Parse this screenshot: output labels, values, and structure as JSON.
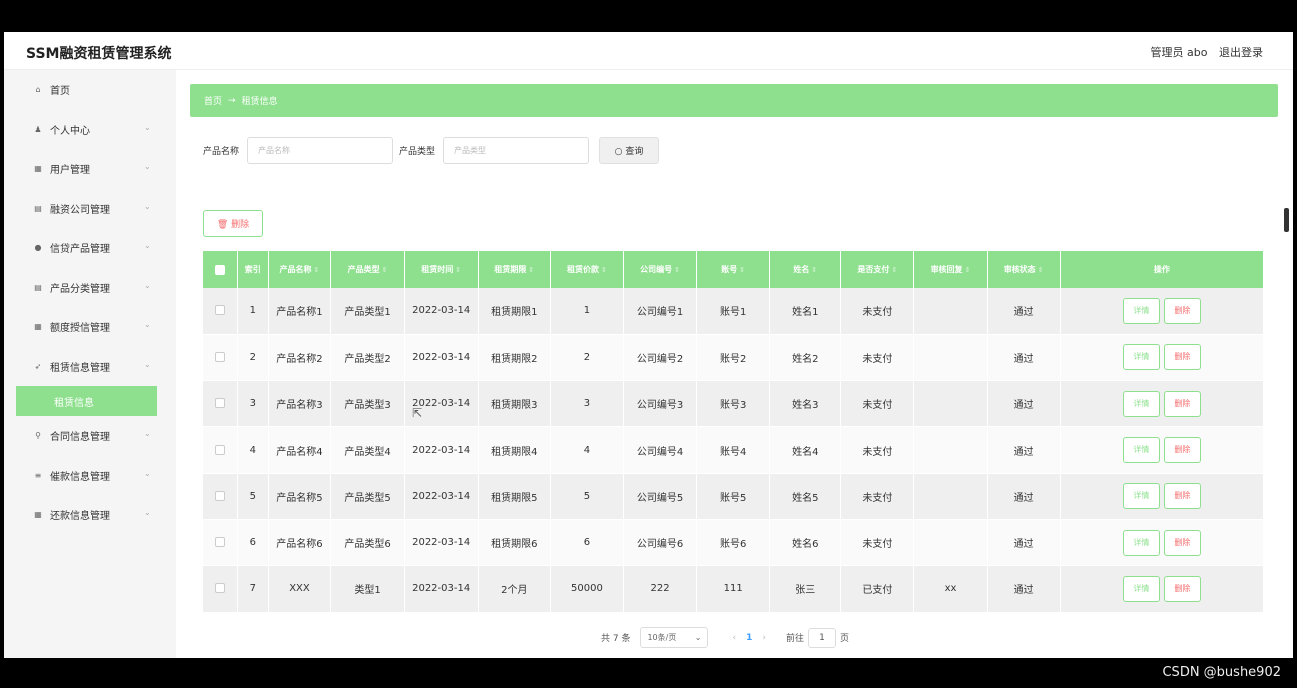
{
  "header": {
    "brand": "SSM融资租赁管理系统",
    "user": "管理员 abo",
    "logout": "退出登录"
  },
  "sidebar": {
    "items": [
      {
        "label": "首页",
        "icon": "home-icon",
        "glyph": "⌂",
        "expand": false
      },
      {
        "label": "个人中心",
        "icon": "user-icon",
        "glyph": "♟",
        "expand": true
      },
      {
        "label": "用户管理",
        "icon": "grid-icon",
        "glyph": "▦",
        "expand": true
      },
      {
        "label": "融资公司管理",
        "icon": "list-icon",
        "glyph": "▤",
        "expand": true
      },
      {
        "label": "信贷产品管理",
        "icon": "pin-icon",
        "glyph": "●",
        "expand": true
      },
      {
        "label": "产品分类管理",
        "icon": "list-icon",
        "glyph": "▤",
        "expand": true
      },
      {
        "label": "额度授信管理",
        "icon": "grid-icon",
        "glyph": "▦",
        "expand": true
      },
      {
        "label": "租赁信息管理",
        "icon": "send-icon",
        "glyph": "➶",
        "expand": true
      }
    ],
    "active_sub": "租赁信息",
    "items_after": [
      {
        "label": "合同信息管理",
        "icon": "pin-icon",
        "glyph": "⚲",
        "expand": true
      },
      {
        "label": "催款信息管理",
        "icon": "stack-icon",
        "glyph": "≡",
        "expand": true
      },
      {
        "label": "还款信息管理",
        "icon": "grid-icon",
        "glyph": "▦",
        "expand": true
      }
    ]
  },
  "breadcrumb": {
    "home": "首页",
    "arrow": "→",
    "current": "租赁信息"
  },
  "search": {
    "name_label": "产品名称",
    "name_placeholder": "产品名称",
    "type_label": "产品类型",
    "type_placeholder": "产品类型",
    "button": "○ 查询"
  },
  "delete_button": "🗑 删除",
  "table": {
    "headers": [
      "索引",
      "产品名称",
      "产品类型",
      "租赁时间",
      "租赁期限",
      "租赁价款",
      "公司编号",
      "账号",
      "姓名",
      "是否支付",
      "审核回复",
      "审核状态",
      "操作"
    ],
    "rows": [
      [
        "1",
        "产品名称1",
        "产品类型1",
        "2022-03-14",
        "租赁期限1",
        "1",
        "公司编号1",
        "账号1",
        "姓名1",
        "未支付",
        "",
        "通过"
      ],
      [
        "2",
        "产品名称2",
        "产品类型2",
        "2022-03-14",
        "租赁期限2",
        "2",
        "公司编号2",
        "账号2",
        "姓名2",
        "未支付",
        "",
        "通过"
      ],
      [
        "3",
        "产品名称3",
        "产品类型3",
        "2022-03-14",
        "租赁期限3",
        "3",
        "公司编号3",
        "账号3",
        "姓名3",
        "未支付",
        "",
        "通过"
      ],
      [
        "4",
        "产品名称4",
        "产品类型4",
        "2022-03-14",
        "租赁期限4",
        "4",
        "公司编号4",
        "账号4",
        "姓名4",
        "未支付",
        "",
        "通过"
      ],
      [
        "5",
        "产品名称5",
        "产品类型5",
        "2022-03-14",
        "租赁期限5",
        "5",
        "公司编号5",
        "账号5",
        "姓名5",
        "未支付",
        "",
        "通过"
      ],
      [
        "6",
        "产品名称6",
        "产品类型6",
        "2022-03-14",
        "租赁期限6",
        "6",
        "公司编号6",
        "账号6",
        "姓名6",
        "未支付",
        "",
        "通过"
      ],
      [
        "7",
        "XXX",
        "类型1",
        "2022-03-14",
        "2个月",
        "50000",
        "222",
        "111",
        "张三",
        "已支付",
        "xx",
        "通过"
      ]
    ],
    "detail_label": "详情",
    "delete_label": "删除"
  },
  "pager": {
    "total": "共 7 条",
    "size": "10条/页",
    "prev": "‹",
    "current": "1",
    "next": "›",
    "goto": "前往",
    "goto_value": "1",
    "page": "页"
  },
  "watermark": "CSDN @bushe902",
  "colors": {
    "accent": "#8ee08e",
    "danger": "#f56c6c",
    "page_active": "#409eff"
  }
}
